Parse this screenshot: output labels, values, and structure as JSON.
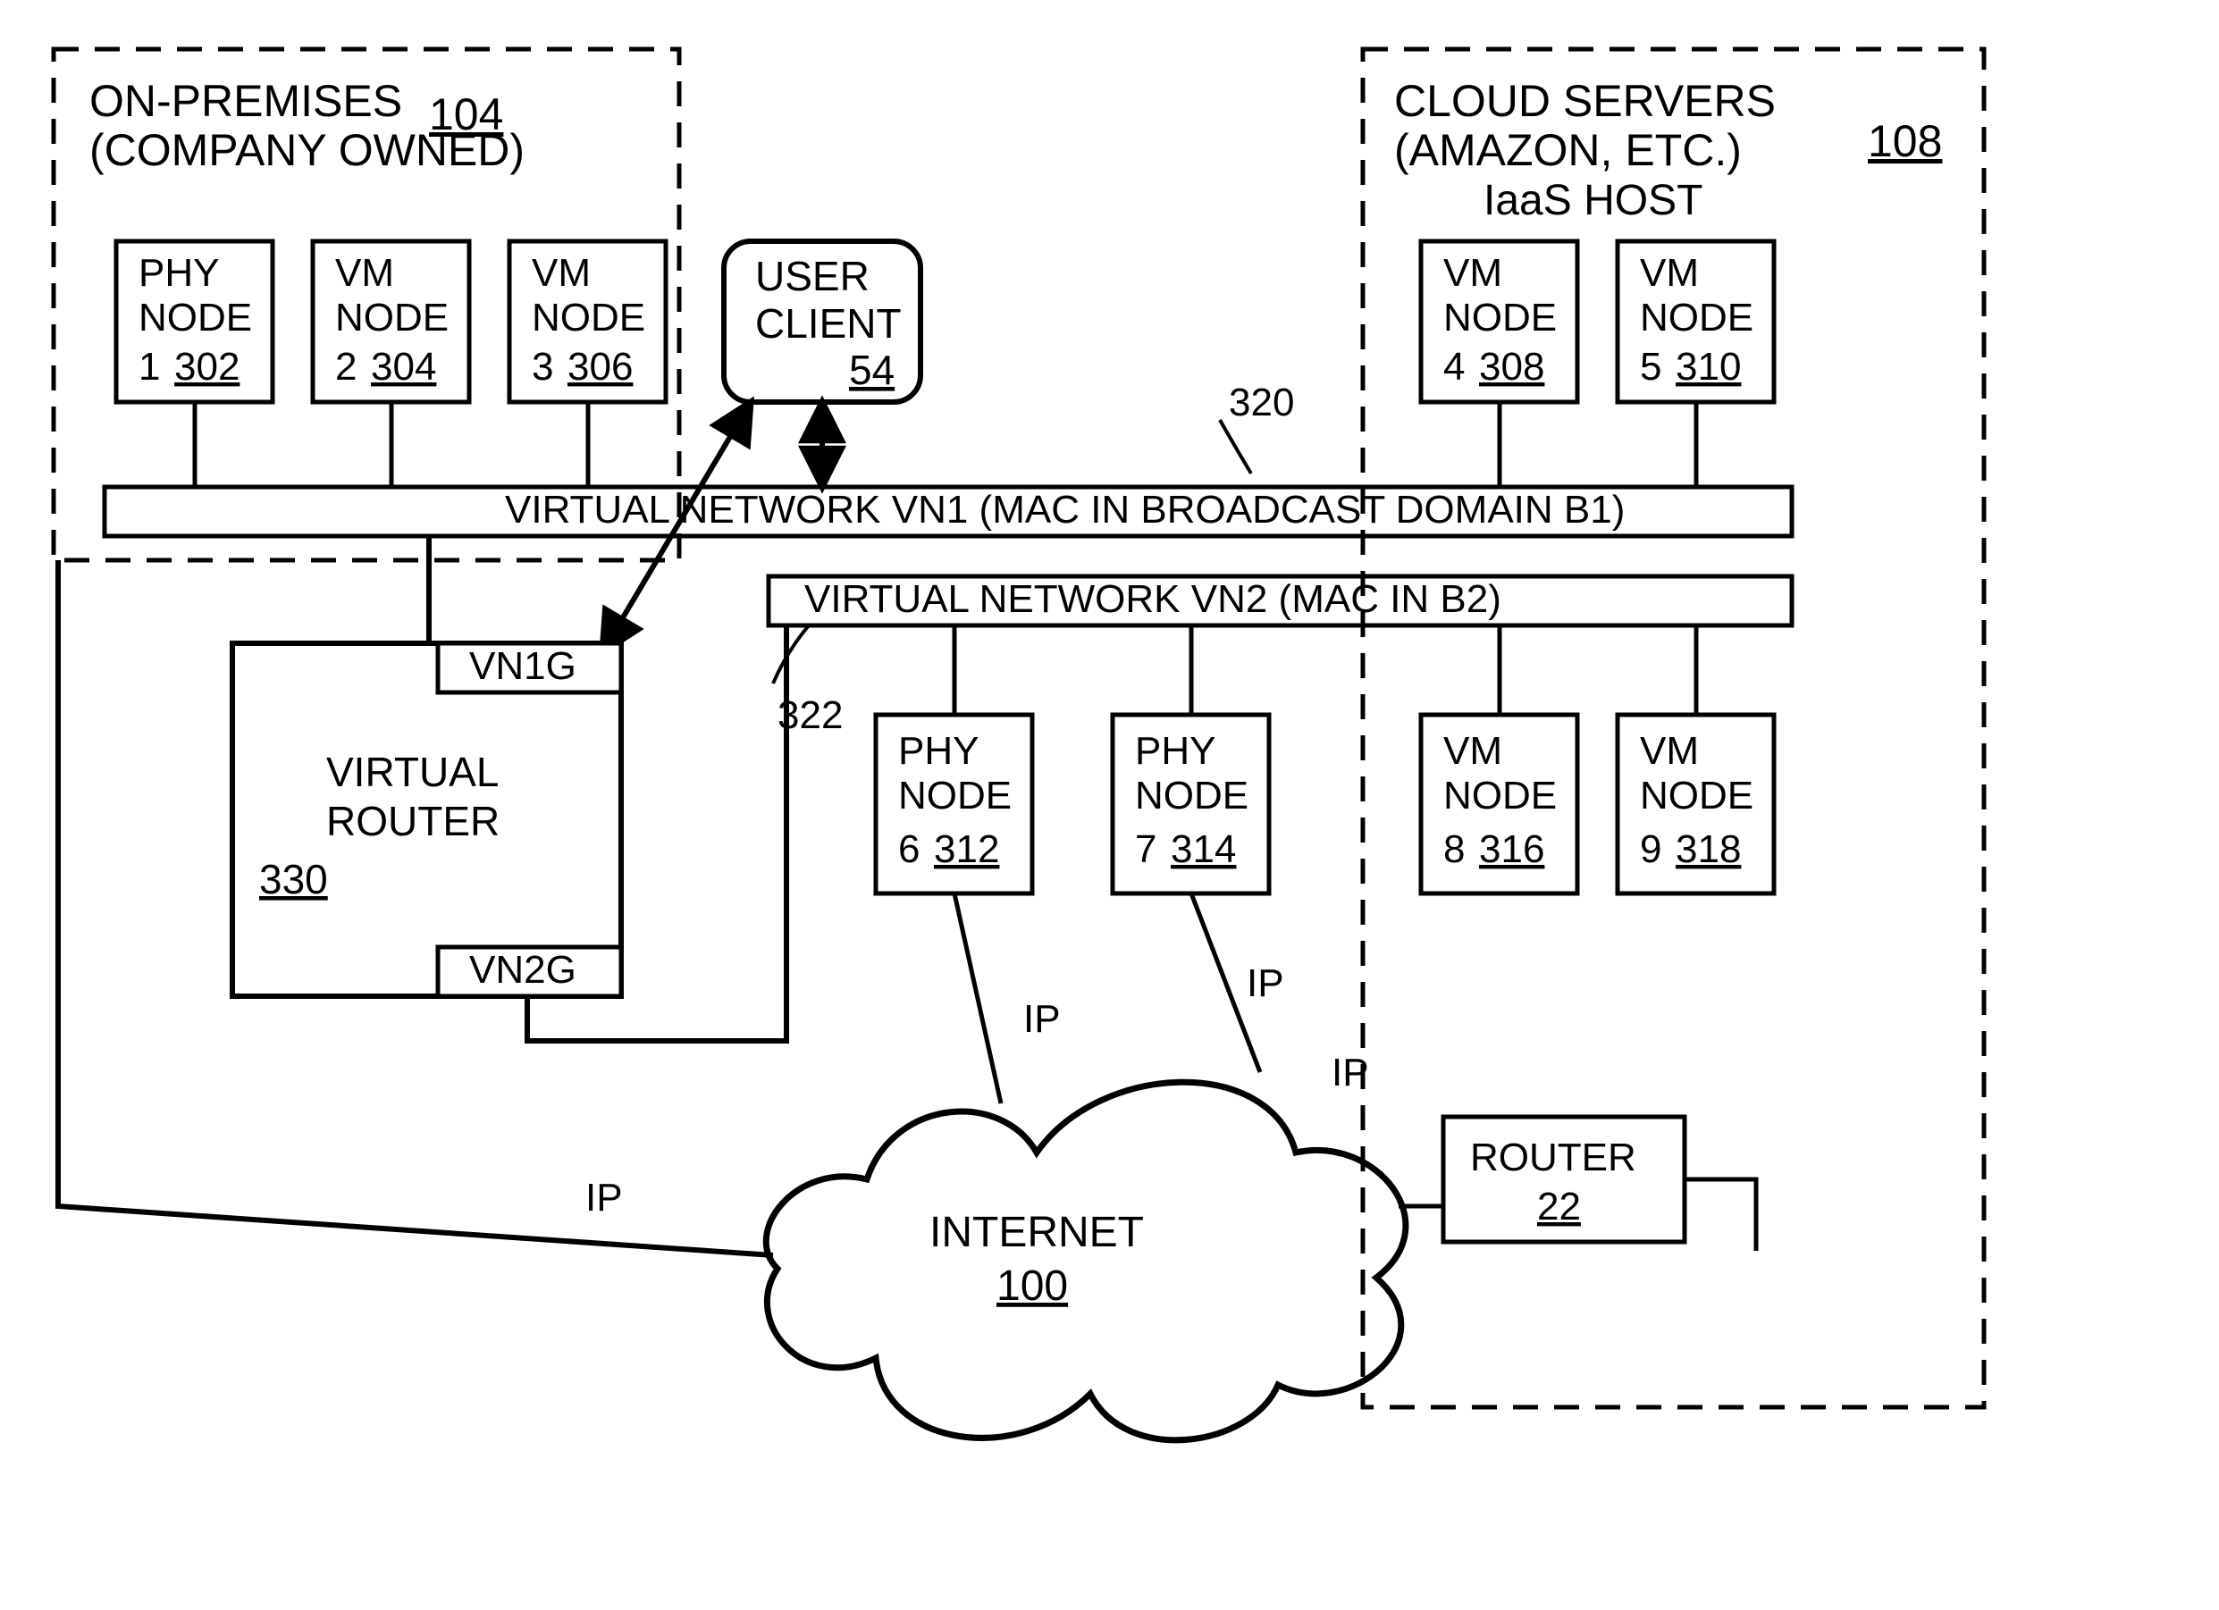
{
  "onprem": {
    "title1": "ON-PREMISES",
    "title2": "(COMPANY OWNED)",
    "ref": "104"
  },
  "cloud": {
    "title1": "CLOUD SERVERS",
    "title2": "(AMAZON, ETC.)",
    "title3": "IaaS HOST",
    "ref": "108"
  },
  "nodes": {
    "n1": {
      "l1": "PHY",
      "l2": "NODE",
      "num": "1",
      "ref": "302"
    },
    "n2": {
      "l1": "VM",
      "l2": "NODE",
      "num": "2",
      "ref": "304"
    },
    "n3": {
      "l1": "VM",
      "l2": "NODE",
      "num": "3",
      "ref": "306"
    },
    "n4": {
      "l1": "VM",
      "l2": "NODE",
      "num": "4",
      "ref": "308"
    },
    "n5": {
      "l1": "VM",
      "l2": "NODE",
      "num": "5",
      "ref": "310"
    },
    "n6": {
      "l1": "PHY",
      "l2": "NODE",
      "num": "6",
      "ref": "312"
    },
    "n7": {
      "l1": "PHY",
      "l2": "NODE",
      "num": "7",
      "ref": "314"
    },
    "n8": {
      "l1": "VM",
      "l2": "NODE",
      "num": "8",
      "ref": "316"
    },
    "n9": {
      "l1": "VM",
      "l2": "NODE",
      "num": "9",
      "ref": "318"
    }
  },
  "user_client": {
    "l1": "USER",
    "l2": "CLIENT",
    "ref": "54"
  },
  "vn1": {
    "label": "VIRTUAL   NETWORK   VN1    (MAC IN BROADCAST DOMAIN B1)",
    "ref": "320"
  },
  "vn2": {
    "label": "VIRTUAL NETWORK   VN2       (MAC IN B2)",
    "ref": "322"
  },
  "vrouter": {
    "l1": "VIRTUAL",
    "l2": "ROUTER",
    "ref": "330",
    "g1": "VN1G",
    "g2": "VN2G"
  },
  "internet": {
    "label": "INTERNET",
    "ref": "100"
  },
  "router": {
    "label": "ROUTER",
    "ref": "22"
  },
  "ip": {
    "a": "IP",
    "b": "IP",
    "c": "IP",
    "d": "IP"
  }
}
